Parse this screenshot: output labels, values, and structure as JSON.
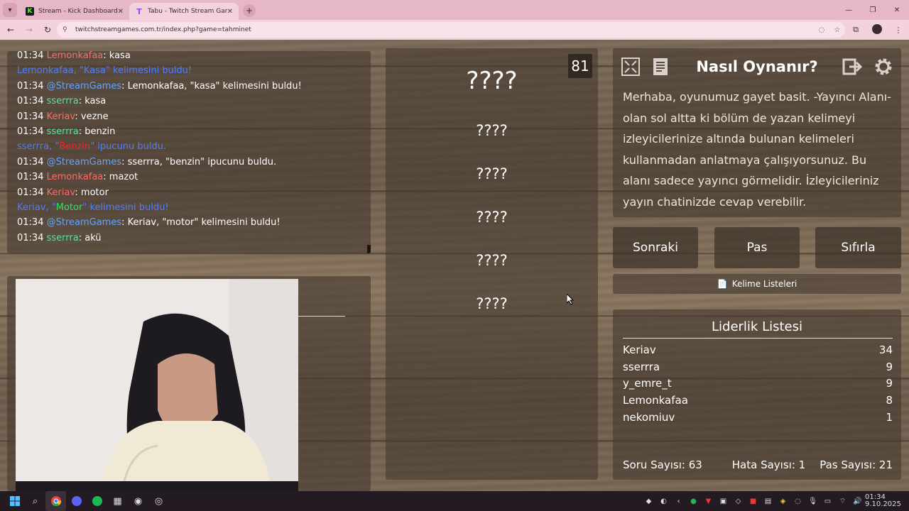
{
  "browser": {
    "tabs": [
      {
        "title": "Stream - Kick Dashboard",
        "icon": "kick-icon",
        "active": false
      },
      {
        "title": "Tabu - Twitch Stream Games",
        "icon": "twitch-icon",
        "active": true
      }
    ],
    "url": "twitchstreamgames.com.tr/index.php?game=tahminet"
  },
  "chat": {
    "lines": [
      {
        "time": "01:34",
        "user": "Lemonkafaa",
        "msg": ": kasa"
      },
      {
        "system": "Lemonkafaa, \"Kasa\" kelimesini buldu!"
      },
      {
        "time": "01:34",
        "user": "@StreamGames",
        "msg": ": Lemonkafaa, \"kasa\" kelimesini buldu!"
      },
      {
        "time": "01:34",
        "user": "sserrra",
        "msg": ": kasa"
      },
      {
        "time": "01:34",
        "user": "Keriav",
        "msg": ": vezne"
      },
      {
        "time": "01:34",
        "user": "sserrra",
        "msg": ": benzin"
      },
      {
        "system_pre": "sserrra, \"",
        "system_hl": "Benzin",
        "system_post": "\" ipucunu buldu."
      },
      {
        "time": "01:34",
        "user": "@StreamGames",
        "msg": ": sserrra, \"benzin\" ipucunu buldu."
      },
      {
        "time": "01:34",
        "user": "Lemonkafaa",
        "msg": ": mazot"
      },
      {
        "time": "01:34",
        "user": "Keriav",
        "msg": ": motor"
      },
      {
        "system_pre": "Keriav, \"",
        "system_hl": "Motor",
        "system_post": "\" kelimesini buldu!"
      },
      {
        "time": "01:34",
        "user": "@StreamGames",
        "msg": ": Keriav, \"motor\" kelimesini buldu!"
      },
      {
        "time": "01:34",
        "user": "sserrra",
        "msg": ": akü"
      }
    ]
  },
  "game": {
    "timer": "81",
    "main_word": "????",
    "taboo_words": [
      "????",
      "????",
      "????",
      "????",
      "????"
    ]
  },
  "howto": {
    "title": "Nasıl Oynanır?",
    "text": "Merhaba, oyunumuz gayet basit. -Yayıncı Alanı- olan sol altta ki bölüm de yazan kelimeyi izleyicilerinize altında bulunan kelimeleri kullanmadan anlatmaya çalışıyorsunuz. Bu alanı sadece yayıncı görmelidir. İzleyicileriniz yayın chatinizde cevap verebilir."
  },
  "buttons": {
    "next": "Sonraki",
    "pass": "Pas",
    "reset": "Sıfırla",
    "word_lists": "Kelime Listeleri"
  },
  "leaderboard": {
    "title": "Liderlik Listesi",
    "rows": [
      {
        "name": "Keriav",
        "score": "34"
      },
      {
        "name": "sserrra",
        "score": "9"
      },
      {
        "name": "y_emre_t",
        "score": "9"
      },
      {
        "name": "Lemonkafaa",
        "score": "8"
      },
      {
        "name": "nekomiuv",
        "score": "1"
      }
    ],
    "questions": "Soru Sayısı: 63",
    "errors": "Hata Sayısı: 1",
    "passes": "Pas Sayısı: 21"
  },
  "taskbar": {
    "time": "01:34",
    "date": "9.10.2025"
  },
  "colors": {
    "user_red": "#ff6b6b",
    "user_blue": "#63a4ff",
    "user_green": "#5de3a4",
    "system_blue": "#4f7dff"
  }
}
